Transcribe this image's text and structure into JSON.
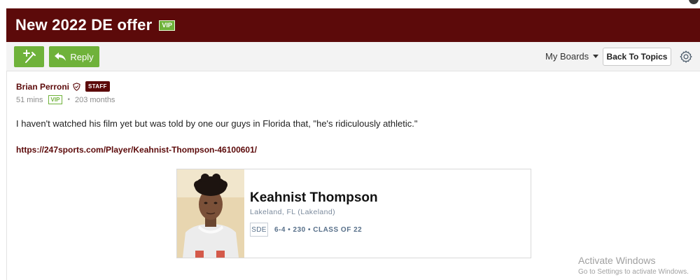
{
  "header": {
    "title": "New 2022 DE offer",
    "vip_badge": "VIP",
    "colors": {
      "brand": "#5c0a0a",
      "accent_green": "#6fb23a"
    }
  },
  "toolbar": {
    "new_post_icon": "magic-wand-plus-icon",
    "reply_label": "Reply",
    "reply_icon": "reply-arrow-icon",
    "my_boards_label": "My Boards",
    "back_to_topics_label": "Back To Topics",
    "settings_icon": "gear-icon"
  },
  "post": {
    "author": "Brian Perroni",
    "author_icon": "shield-icon",
    "staff_badge": "STAFF",
    "time_ago": "51 mins",
    "vip_badge": "VIP",
    "member_for": "203 months",
    "body": "I haven't watched his film yet but was told by one our guys in Florida that, \"he's ridiculously athletic.\"",
    "link": "https://247sports.com/Player/Keahnist-Thompson-46100601/"
  },
  "player_card": {
    "name": "Keahnist Thompson",
    "location": "Lakeland, FL (Lakeland)",
    "position": "SDE",
    "stats": "6-4 • 230 • CLASS OF 22"
  },
  "watermark": {
    "title": "Activate Windows",
    "subtitle": "Go to Settings to activate Windows."
  }
}
